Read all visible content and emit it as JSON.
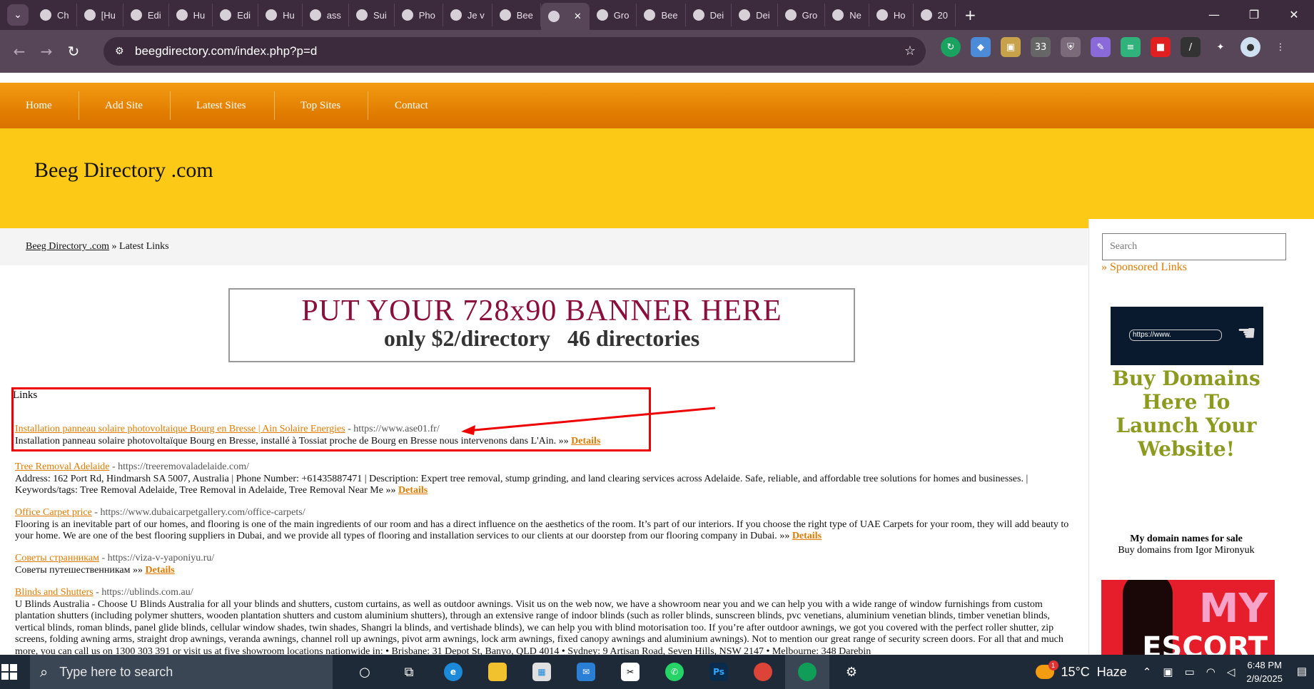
{
  "browser": {
    "tabs": [
      {
        "label": "Ch",
        "icon": "globe-icon"
      },
      {
        "label": "[Hu",
        "icon": "gmail-icon"
      },
      {
        "label": "Edi",
        "icon": "globe-icon"
      },
      {
        "label": "Hu",
        "icon": "globe-icon"
      },
      {
        "label": "Edi",
        "icon": "globe-icon"
      },
      {
        "label": "Hu",
        "icon": "instagram-icon"
      },
      {
        "label": "ass",
        "icon": "google-icon"
      },
      {
        "label": "Sui",
        "icon": "app-icon"
      },
      {
        "label": "Pho",
        "icon": "app-icon"
      },
      {
        "label": "Je v",
        "icon": "sheets-icon"
      },
      {
        "label": "Bee",
        "icon": "globe-icon"
      },
      {
        "label": "",
        "icon": "globe-icon",
        "active": true
      },
      {
        "label": "Gro",
        "icon": "globe-icon"
      },
      {
        "label": "Bee",
        "icon": "globe-icon"
      },
      {
        "label": "Dei",
        "icon": "globe-icon"
      },
      {
        "label": "Dei",
        "icon": "globe-icon"
      },
      {
        "label": "Gro",
        "icon": "globe-icon"
      },
      {
        "label": "Ne",
        "icon": "app-icon"
      },
      {
        "label": "Ho",
        "icon": "app-icon"
      },
      {
        "label": "20",
        "icon": "app-icon"
      }
    ],
    "url": "beegdirectory.com/index.php?p=d"
  },
  "site": {
    "nav": [
      "Home",
      "Add Site",
      "Latest Sites",
      "Top Sites",
      "Contact"
    ],
    "title": "Beeg Directory .com",
    "breadcrumb_home": "Beeg Directory .com",
    "breadcrumb_sep": " » ",
    "breadcrumb_current": "Latest Links",
    "search_placeholder": "Search",
    "banner_line1": "PUT YOUR 728x90 BANNER HERE",
    "banner_line2": "only $2/directory   46 directories",
    "links_heading": "Links",
    "details_label": "Details",
    "details_prefix": " »» ",
    "entries": [
      {
        "title": "Installation panneau solaire photovoltaique Bourg en Bresse | Ain Solaire Energies",
        "url": " - https://www.ase01.fr/",
        "desc": "Installation panneau solaire photovoltaïque Bourg en Bresse, installé à Tossiat proche de Bourg en Bresse nous intervenons dans L'Ain."
      },
      {
        "title": "Tree Removal Adelaide",
        "url": " - https://treeremovaladelaide.com/",
        "desc": "Address: 162 Port Rd, Hindmarsh SA 5007, Australia | Phone Number: +61435887471 | Description: Expert tree removal, stump grinding, and land clearing services across Adelaide. Safe, reliable, and affordable tree solutions for homes and businesses. | Keywords/tags: Tree Removal Adelaide, Tree Removal in Adelaide, Tree Removal Near Me"
      },
      {
        "title": "Office Carpet price",
        "url": " - https://www.dubaicarpetgallery.com/office-carpets/",
        "desc": "Flooring is an inevitable part of our homes, and flooring is one of the main ingredients of our room and has a direct influence on the aesthetics of the room. It’s part of our interiors. If you choose the right type of UAE Carpets for your room, they will add beauty to your home. We are one of the best flooring suppliers in Dubai, and we provide all types of flooring and installation services to our clients at our doorstep from our flooring company in Dubai."
      },
      {
        "title": "Советы странникам",
        "url": " - https://viza-v-yaponiyu.ru/",
        "desc": "Советы путешественникам"
      },
      {
        "title": "Blinds and Shutters",
        "url": " - https://ublinds.com.au/",
        "desc": "U Blinds Australia - Choose U Blinds Australia for all your blinds and shutters, custom curtains, as well as outdoor awnings. Visit us on the web now, we have a showroom near you and we can help you with a wide range of window furnishings from custom plantation shutters (including polymer shutters, wooden plantation shutters and custom aluminium shutters), through an extensive range of indoor blinds (such as roller blinds, sunscreen blinds, pvc venetians, aluminium venetian blinds, timber venetian blinds, vertical blinds, roman blinds, panel glide blinds, cellular window shades, twin shades, Shangri la blinds, and vertishade blinds), we can help you with blind motorisation too. If you’re after outdoor awnings, we got you covered with the perfect roller shutter, zip screens, folding awning arms, straight drop awnings, veranda awnings, channel roll up awnings, pivot arm awnings, lock arm awnings, fixed canopy awnings and aluminium awnings). Not to mention our great range of security screen doors. For all that and much more, you can call us on 1300 303 391 or visit us at five showroom locations nationwide in: • Brisbane: 31 Depot St, Banyo, QLD 4014 • Sydney: 9 Artisan Road, Seven Hills, NSW 2147 • Melbourne: 348 Darebin"
      }
    ],
    "sidebar": {
      "sponsored_title": "Sponsored Links",
      "domain_ad_url": "https://www.",
      "domain_ad_text": "Buy Domains Here To Launch Your Website!",
      "domain_ad_sub1": "My domain names for sale",
      "domain_ad_sub2": "Buy domains from Igor Mironyuk",
      "escort_ad_line1": "MY",
      "escort_ad_line2": "ESCORT"
    }
  },
  "taskbar": {
    "search_placeholder": "Type here to search",
    "weather": "15°C  Haze",
    "weather_badge": "1",
    "time": "6:48 PM",
    "date": "2/9/2025"
  },
  "colors": {
    "accent_orange": "#e07b00",
    "header_yellow": "#fcc916",
    "annotation_red": "#e00000"
  }
}
